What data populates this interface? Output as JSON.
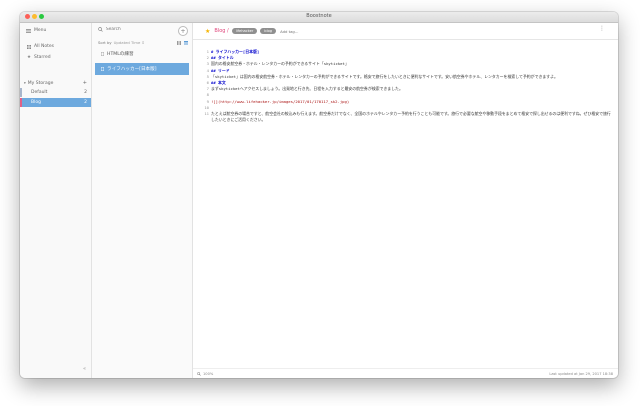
{
  "window": {
    "title": "Boostnote"
  },
  "sidebar": {
    "menu_label": "Menu",
    "all_notes": "All Notes",
    "starred": "Starred",
    "storage": {
      "label": "My Storage",
      "add_icon": "+"
    },
    "folders": [
      {
        "name": "Default",
        "count": "2"
      },
      {
        "name": "Blog",
        "count": "2"
      }
    ],
    "collapse_icon": "«"
  },
  "notelist": {
    "search_placeholder": "Search",
    "new_note_icon": "+",
    "sort_label": "Sort by",
    "sort_value": "Updated Time ⇕",
    "notes": [
      {
        "title": "HTMLの練習"
      },
      {
        "title": "ライフハッカー[日本版]"
      }
    ]
  },
  "editor": {
    "folder": "Blog /",
    "tags": [
      "lifehacker",
      "blog"
    ],
    "add_tag_placeholder": "Add tag...",
    "more_icon": "⋮",
    "lines": [
      {
        "n": "1",
        "text": "# ライフハッカー[日本版]",
        "style": "h1"
      },
      {
        "n": "2",
        "text": "## タイトル",
        "style": "h1"
      },
      {
        "n": "3",
        "text": "国内の格安航空券・ホテル・レンタカーの予約ができるサイト「skyticket」",
        "style": ""
      },
      {
        "n": "4",
        "text": "## リード",
        "style": "h1"
      },
      {
        "n": "5",
        "text": "「skyticket」は国内の格安航空券・ホテル・レンタカーの予約ができるサイトです。格安で旅行をしたいときに便利なサイトです。安い航空券やホテル、レンタカーを検索して予約ができますよ。",
        "style": ""
      },
      {
        "n": "6",
        "text": "## 本文",
        "style": "h1"
      },
      {
        "n": "7",
        "text": "まずskyticketへアクセスしましょう。出発地と行き先、日程を入力すると最安の航空券が検索できました。",
        "style": ""
      },
      {
        "n": "8",
        "text": "",
        "style": ""
      },
      {
        "n": "9",
        "text": "![](http://www.lifehacker.jp/images/2017/01/170117_sk2.jpg)",
        "style": "link"
      },
      {
        "n": "10",
        "text": "",
        "style": ""
      },
      {
        "n": "11",
        "text": "たとえば航空券の場合ですと、航空会社の絞込みも行えます。航空券だけでなく、全国のホテルやレンタカー予約を行うことも可能です。旅行で必要な航空や移動手段をまとめて格安で探し出せるのは便利ですね。ぜひ格安で旅行したいときにご活用ください。",
        "style": ""
      }
    ],
    "zoom": "100%",
    "updated": "Last updated at Jan 29, 2017 18:38"
  }
}
